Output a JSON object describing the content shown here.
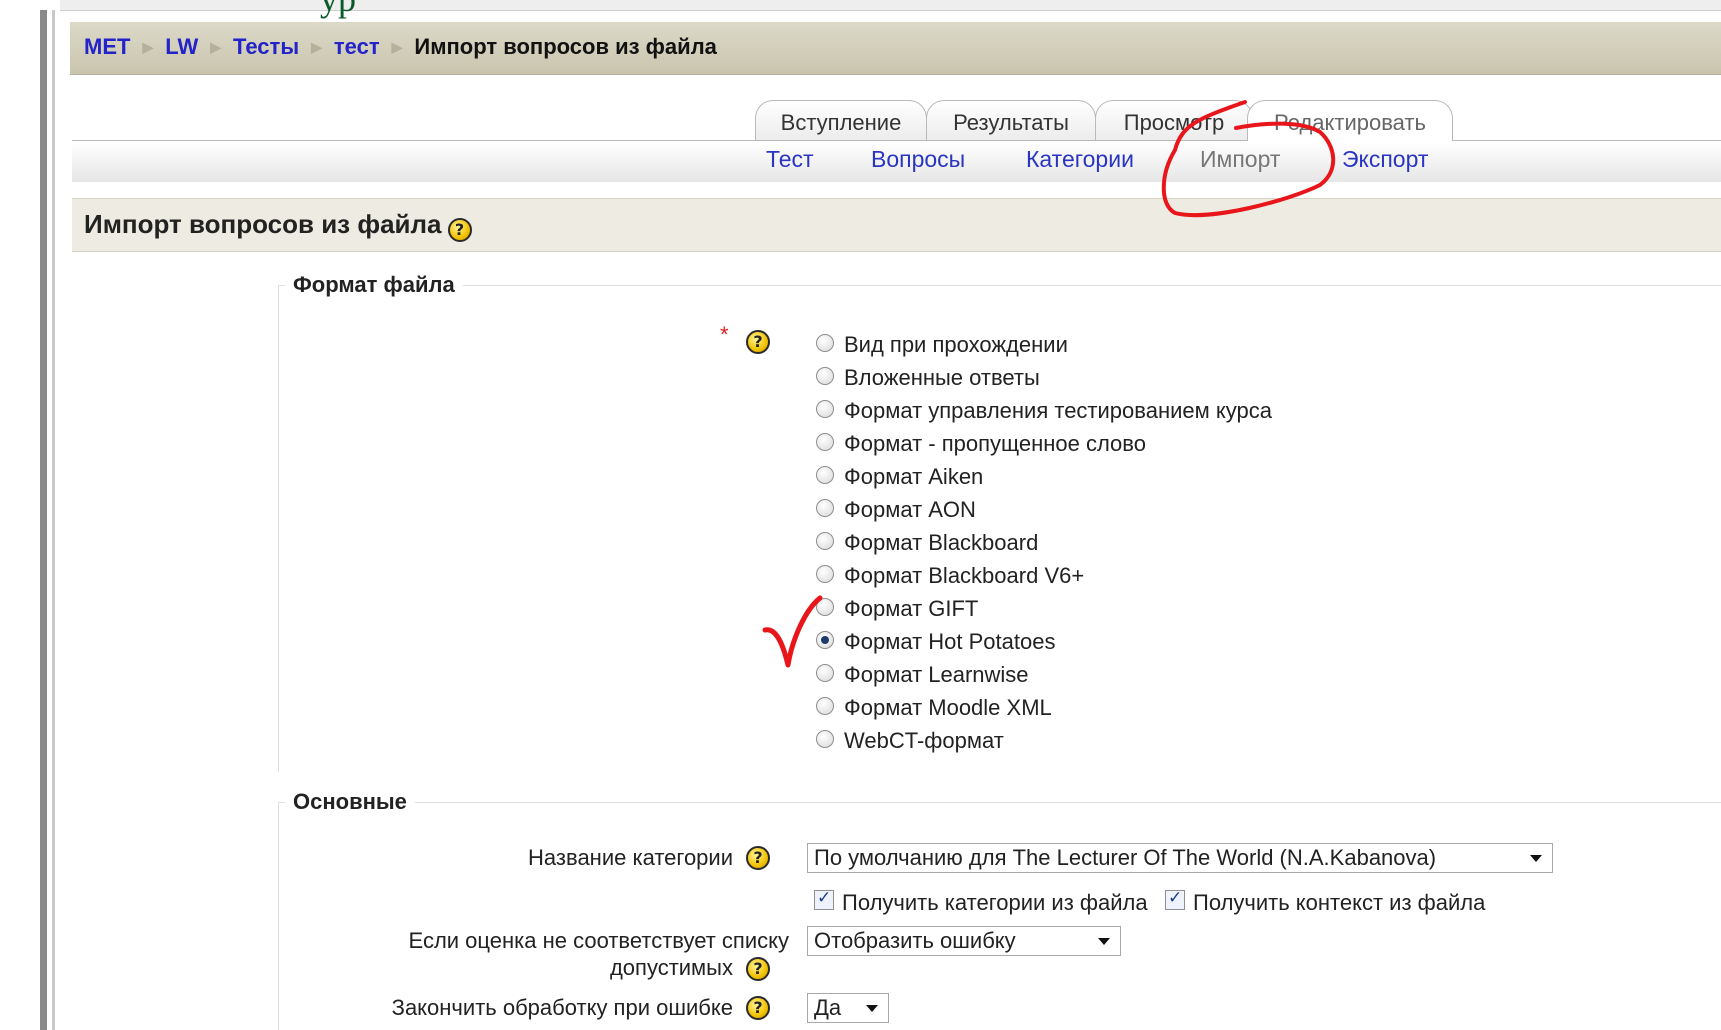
{
  "header_fragment": "ур",
  "breadcrumb": {
    "items": [
      "МЕТ",
      "LW",
      "Тесты",
      "тест"
    ],
    "current": "Импорт вопросов из файла"
  },
  "tabs": [
    "Вступление",
    "Результаты",
    "Просмотр",
    "Редактировать"
  ],
  "subtabs": [
    "Тест",
    "Вопросы",
    "Категории",
    "Импорт",
    "Экспорт"
  ],
  "page_title": "Импорт вопросов из файла",
  "help_glyph": "?",
  "file_format": {
    "legend": "Формат файла",
    "required_mark": "*",
    "options": [
      "Вид при прохождении",
      "Вложенные ответы",
      "Формат управления тестированием курса",
      "Формат - пропущенное слово",
      "Формат Aiken",
      "Формат AON",
      "Формат Blackboard",
      "Формат Blackboard V6+",
      "Формат GIFT",
      "Формат Hot Potatoes",
      "Формат Learnwise",
      "Формат Moodle XML",
      "WebCT-формат"
    ],
    "selected": "Формат Hot Potatoes"
  },
  "general": {
    "legend": "Основные",
    "category_label": "Название категории",
    "category_value": "По умолчанию для The Lecturer Of The World (N.A.Kabanova)",
    "get_categories_label": "Получить категории из файла",
    "get_context_label": "Получить контекст из файла",
    "grade_mismatch_label_line1": "Если оценка не соответствует списку",
    "grade_mismatch_label_line2": "допустимых",
    "grade_mismatch_value": "Отобразить ошибку",
    "stop_on_error_label": "Закончить обработку при ошибке",
    "stop_on_error_value": "Да"
  },
  "colors": {
    "link": "#2323c9",
    "annotation": "#e8161b"
  }
}
